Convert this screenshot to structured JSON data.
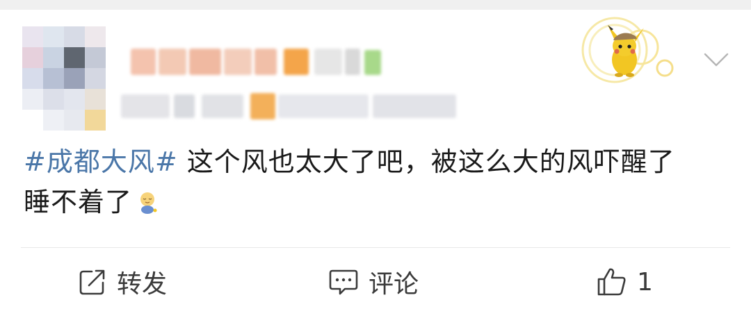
{
  "post": {
    "hashtag": "#成都大风#",
    "text_line1": " 这个风也太大了吧，被这么大的风吓醒了",
    "text_line2": "睡不着了",
    "emoji": "sleepy-face-emoji"
  },
  "actions": {
    "repost_label": "转发",
    "comment_label": "评论",
    "like_count": "1"
  },
  "icons": {
    "repost": "repost-icon",
    "comment": "comment-icon",
    "like": "thumbs-up-icon",
    "more": "chevron-down-icon"
  },
  "colors": {
    "hashtag": "#4a76a8",
    "text": "#1a1a1a",
    "action": "#3a3a3a"
  }
}
